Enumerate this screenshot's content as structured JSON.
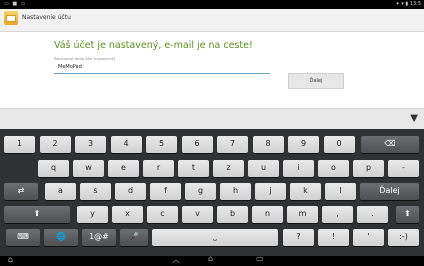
{
  "status_bar": {
    "left_icons": "▭ ■ ▭",
    "right_icons": "✦ ▾ ▮ 13:5"
  },
  "action_bar": {
    "title": "Nastavenie účtu"
  },
  "main": {
    "heading": "Váš účet je nastavený, e-mail je na ceste!",
    "field_label": "Pomenovať tento účet (nepovinné)",
    "field_value": "MeMoPad",
    "next_button": "Ďalej"
  },
  "suggestion_bar": {
    "collapse_icon": "▼"
  },
  "keyboard": {
    "row1": [
      "1",
      "2",
      "3",
      "4",
      "5",
      "6",
      "7",
      "8",
      "9",
      "0"
    ],
    "row2": [
      "q",
      "w",
      "e",
      "r",
      "t",
      "z",
      "u",
      "i",
      "o",
      "p",
      "-"
    ],
    "row3": [
      "a",
      "s",
      "d",
      "f",
      "g",
      "h",
      "j",
      "k",
      "l"
    ],
    "row4": [
      "y",
      "x",
      "c",
      "v",
      "b",
      "n",
      "m",
      ",",
      "."
    ],
    "row5": [
      "?",
      "!",
      "'",
      ":-)"
    ],
    "labels": {
      "backspace": "⌫",
      "tab": "⇄",
      "enter": "Ďalej",
      "shift": "⬆",
      "symbols": "1@#",
      "space": "⎵",
      "mic": "🎤",
      "globe": "🌐",
      "kb": "⌨"
    }
  },
  "nav_bar": {
    "home": "⌂",
    "back": "︿",
    "house": "⌂",
    "recent": "▭"
  }
}
